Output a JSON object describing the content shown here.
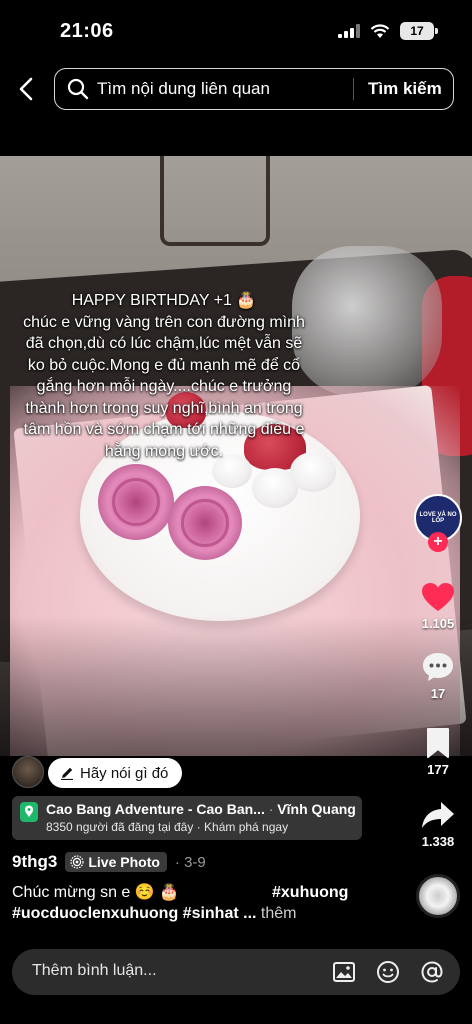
{
  "status_bar": {
    "time": "21:06",
    "battery": "17"
  },
  "search": {
    "query": "Tìm nội dung liên quan",
    "submit_label": "Tìm kiếm"
  },
  "overlay": {
    "lines": [
      "HAPPY BIRTHDAY +1 🎂",
      "chúc e vững vàng trên con đường mình",
      "đã chọn,dù có lúc chậm,lúc mệt vẫn sẽ",
      "ko bỏ cuộc.Mong e đủ mạnh mẽ để cố",
      "gắng hơn mỗi ngày....chúc e trưởng",
      "thành hơn trong suy nghĩ,bình an trong",
      "tâm hồn và sớm chạm tới những điều e",
      "hằng mong ước."
    ]
  },
  "creator_avatar_text": "LOVE VÀ NO LỐP",
  "actions": {
    "likes": "1.105",
    "comments": "17",
    "saves": "177",
    "shares": "1.338"
  },
  "say_something": "Hãy nói gì đó",
  "location": {
    "name": "Cao Bang Adventure - Cao Ban...",
    "separator": "·",
    "area": "Vĩnh Quang",
    "subtitle": "8350 người đã đăng tại đây · Khám phá ngay"
  },
  "post": {
    "author": "9thg3",
    "badge": "Live Photo",
    "date": "· 3-9",
    "caption_line1": "Chúc mừng sn e ☺️ 🎂",
    "hashtag1": "#xuhuong",
    "caption_line2": "#uocduoclenxuhuong #sinhat ...",
    "more": "thêm"
  },
  "comment_bar": {
    "placeholder": "Thêm bình luận..."
  },
  "colors": {
    "like": "#ff2d55",
    "background": "#000000",
    "chip": "#ffffff"
  }
}
